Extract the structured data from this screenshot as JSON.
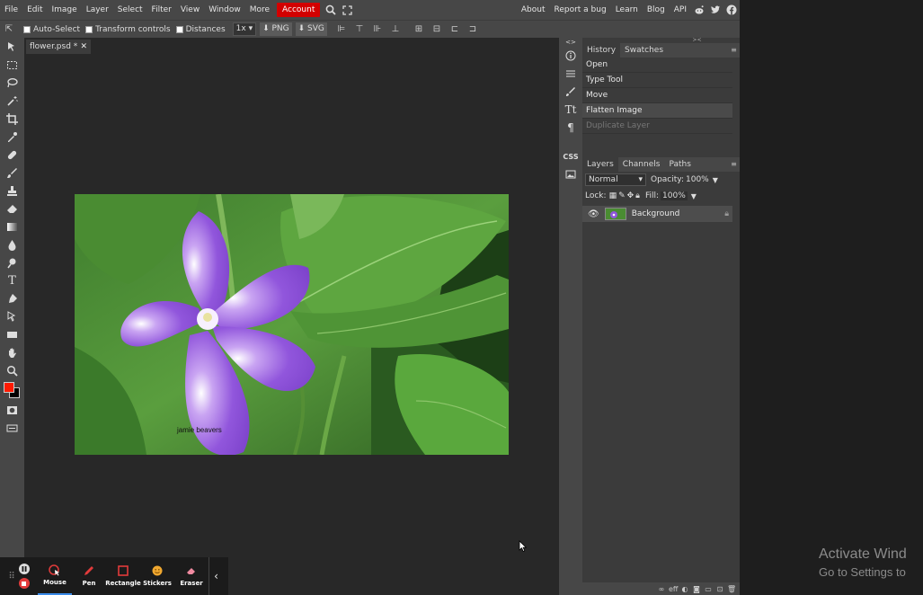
{
  "menu": {
    "items": [
      "File",
      "Edit",
      "Image",
      "Layer",
      "Select",
      "Filter",
      "View",
      "Window",
      "More"
    ],
    "account": "Account",
    "right_links": [
      "About",
      "Report a bug",
      "Learn",
      "Blog",
      "API"
    ]
  },
  "options": {
    "auto_select": "Auto-Select",
    "transform_controls": "Transform controls",
    "distances": "Distances",
    "zoom": "1x",
    "png": "PNG",
    "svg": "SVG"
  },
  "document": {
    "tab_title": "flower.psd *",
    "watermark": "jamie beavers"
  },
  "history": {
    "tabs": [
      "History",
      "Swatches"
    ],
    "items": [
      "Open",
      "Type Tool",
      "Move",
      "Flatten Image",
      "Duplicate Layer"
    ]
  },
  "layers": {
    "tabs": [
      "Layers",
      "Channels",
      "Paths"
    ],
    "blend_mode": "Normal",
    "opacity_label": "Opacity:",
    "opacity": "100%",
    "lock_label": "Lock:",
    "fill_label": "Fill:",
    "fill": "100%",
    "items": [
      {
        "name": "Background"
      }
    ]
  },
  "side_strip": {
    "css_label": "CSS"
  },
  "colors": {
    "foreground": "#ff1a00",
    "background": "#000000",
    "accent": "#d30000"
  },
  "recorder": {
    "tools": [
      "Mouse",
      "Pen",
      "Rectangle",
      "Stickers",
      "Eraser"
    ]
  },
  "watermark_os": {
    "line1": "Activate Wind",
    "line2": "Go to Settings to"
  }
}
